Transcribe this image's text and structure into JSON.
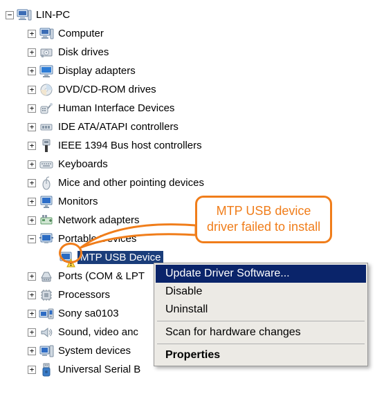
{
  "root": {
    "label": "LIN-PC"
  },
  "categories": [
    {
      "label": "Computer",
      "expander": "+"
    },
    {
      "label": "Disk drives",
      "expander": "+"
    },
    {
      "label": "Display adapters",
      "expander": "+"
    },
    {
      "label": "DVD/CD-ROM drives",
      "expander": "+"
    },
    {
      "label": "Human Interface Devices",
      "expander": "+"
    },
    {
      "label": "IDE ATA/ATAPI controllers",
      "expander": "+"
    },
    {
      "label": "IEEE 1394 Bus host controllers",
      "expander": "+"
    },
    {
      "label": "Keyboards",
      "expander": "+"
    },
    {
      "label": "Mice and other pointing devices",
      "expander": "+"
    },
    {
      "label": "Monitors",
      "expander": "+"
    },
    {
      "label": "Network adapters",
      "expander": "+"
    },
    {
      "label": "Portable Devices",
      "expander": "−"
    },
    {
      "label": "Ports (COM & LPT",
      "expander": "+"
    },
    {
      "label": "Processors",
      "expander": "+"
    },
    {
      "label": "Sony sa0103",
      "expander": "+"
    },
    {
      "label": "Sound, video anc",
      "expander": "+"
    },
    {
      "label": "System devices",
      "expander": "+"
    },
    {
      "label": "Universal Serial B",
      "expander": "+"
    }
  ],
  "selected_device": {
    "label": "MTP USB Device"
  },
  "callout": {
    "line1": "MTP USB device",
    "line2": "driver failed to install"
  },
  "menu": {
    "update": "Update Driver Software...",
    "disable": "Disable",
    "uninstall": "Uninstall",
    "scan": "Scan for hardware changes",
    "properties": "Properties"
  }
}
